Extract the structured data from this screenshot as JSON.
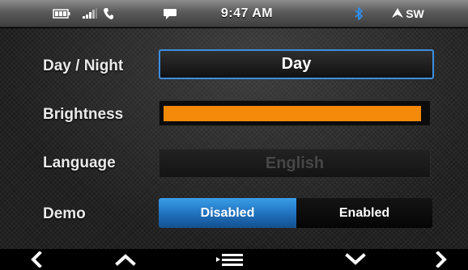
{
  "status_bar": {
    "time": "9:47 AM",
    "compass": "SW",
    "icons": [
      "battery-icon",
      "signal-icon",
      "phone-icon",
      "message-icon",
      "bluetooth-icon",
      "navigation-arrow-icon"
    ]
  },
  "settings": {
    "day_night": {
      "label": "Day / Night",
      "value": "Day"
    },
    "brightness": {
      "label": "Brightness",
      "level_fraction": 0.98,
      "color": "#f58a0a"
    },
    "language": {
      "label": "Language",
      "value": "English"
    },
    "demo": {
      "label": "Demo",
      "options": [
        "Disabled",
        "Enabled"
      ],
      "selected": "Disabled"
    }
  },
  "bottom_nav": {
    "icons": [
      "back-arrow-icon",
      "up-arrow-icon",
      "menu-icon",
      "down-arrow-icon",
      "forward-arrow-icon"
    ]
  },
  "colors": {
    "accent_blue": "#3c8fe0",
    "brightness_orange": "#f58a0a"
  }
}
